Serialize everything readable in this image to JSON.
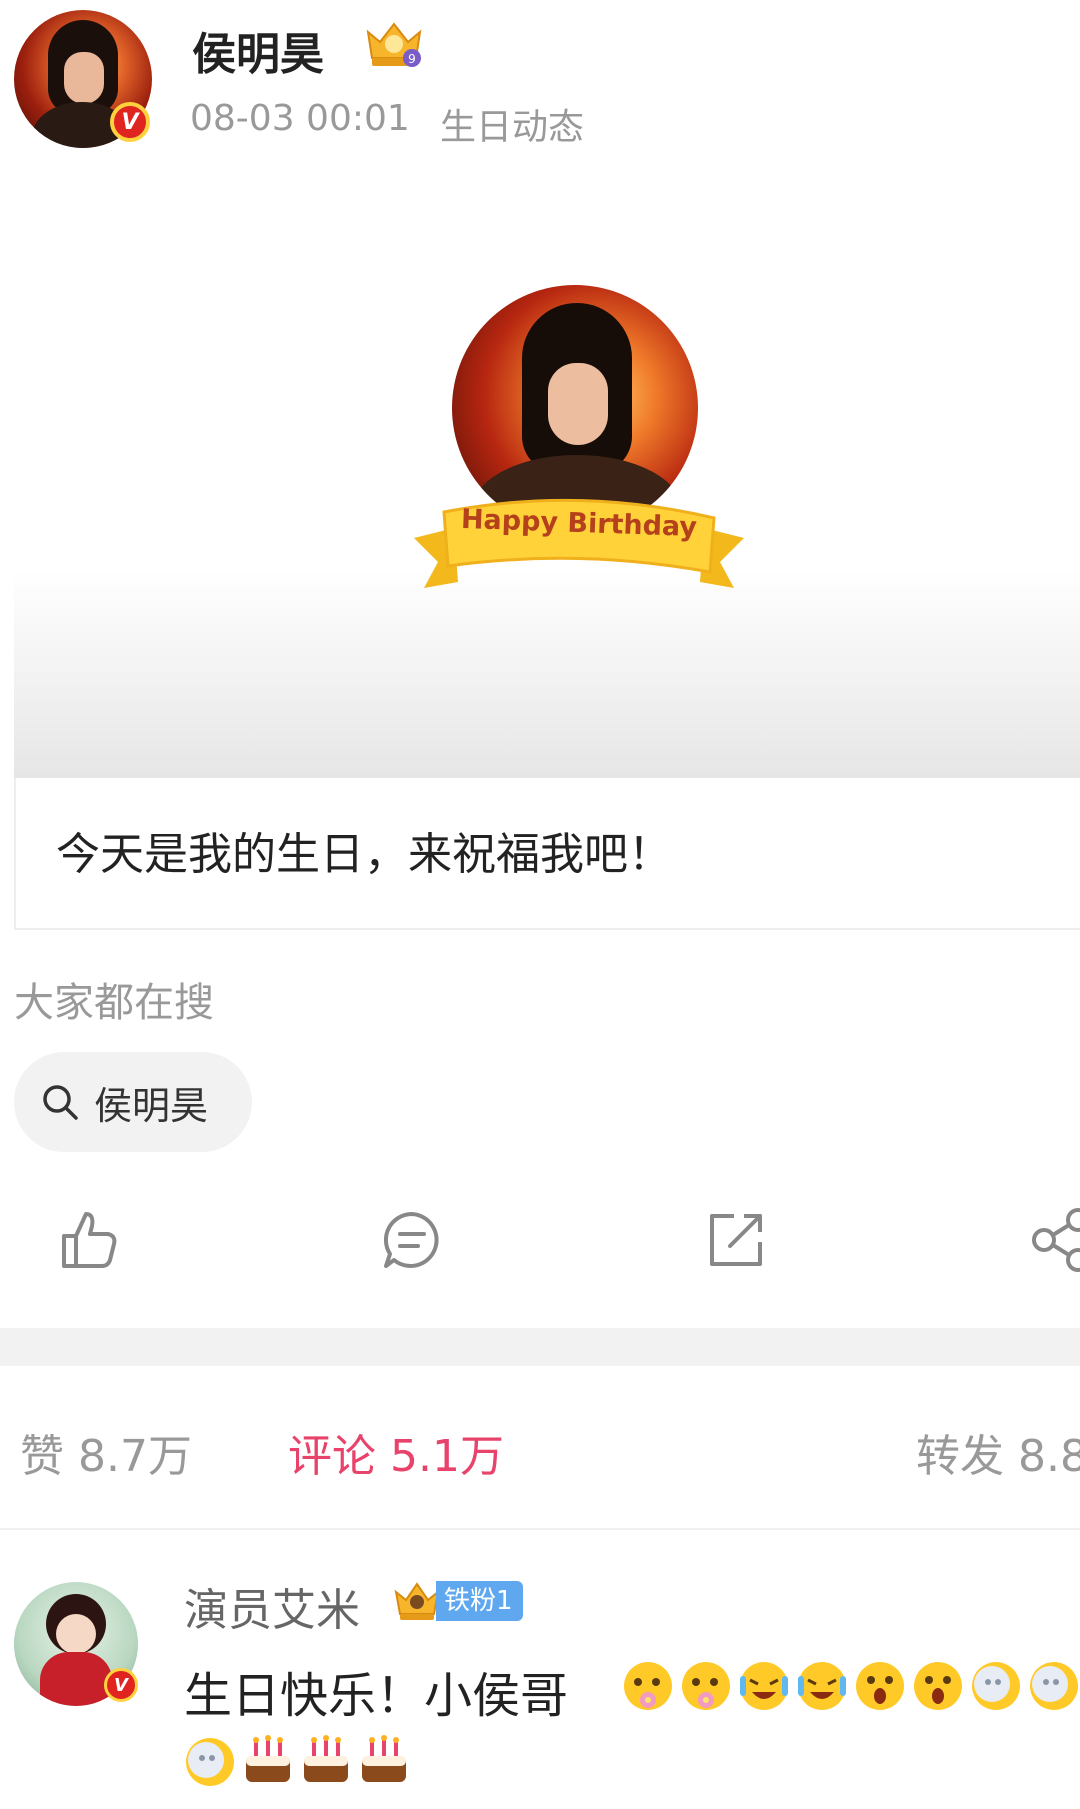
{
  "post": {
    "author": "侯明昊",
    "time": "08-03 00:01",
    "source": "生日动态",
    "card": {
      "ribbon_text": "Happy Birthday",
      "text": "今天是我的生日，来祝福我吧！"
    }
  },
  "search": {
    "title": "大家都在搜",
    "chip_label": "侯明昊"
  },
  "actions": [
    {
      "name": "like-icon"
    },
    {
      "name": "comment-icon"
    },
    {
      "name": "repost-icon"
    },
    {
      "name": "share-icon"
    }
  ],
  "stats": {
    "likes": "赞 8.7万",
    "comments": "评论 5.1万",
    "reposts": "转发 8.8"
  },
  "comment": {
    "user": "演员艾米",
    "fan_badge": "铁粉1",
    "text": "生日快乐！小侯哥",
    "emojis_row1": [
      "flower-face-emoji",
      "flower-face-emoji",
      "laugh-cry-emoji",
      "laugh-cry-emoji",
      "surprised-emoji",
      "surprised-emoji",
      "moon-face-emoji",
      "moon-face-emoji"
    ],
    "emojis_row2": [
      "moon-face-emoji",
      "cake-emoji",
      "cake-emoji",
      "cake-emoji"
    ]
  },
  "colors": {
    "accent_pink": "#e8436a",
    "verified_red": "#e0241f",
    "fan_blue": "#5fa8f0",
    "muted_gray": "#999999"
  }
}
